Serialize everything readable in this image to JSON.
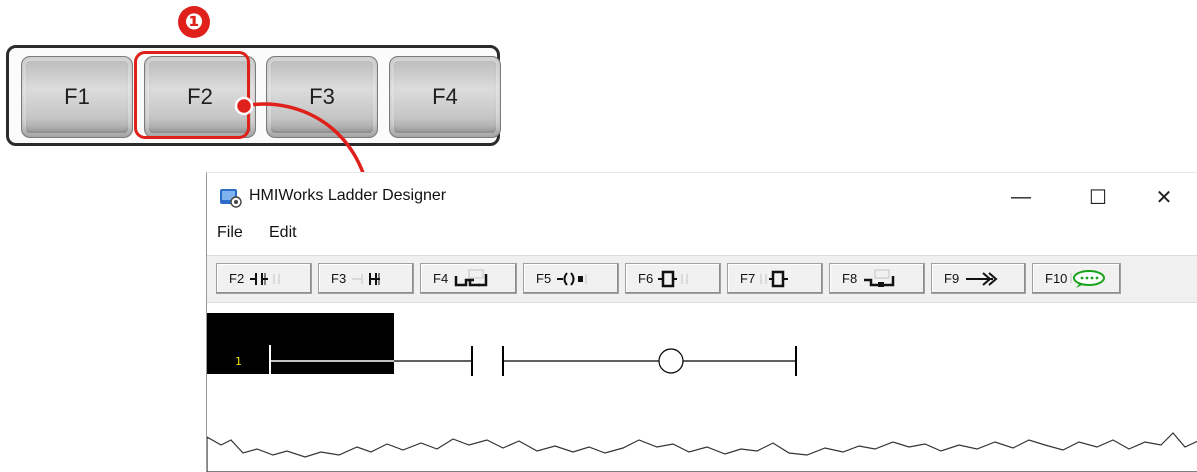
{
  "keyboard": {
    "keys": [
      "F1",
      "F2",
      "F3",
      "F4"
    ],
    "highlighted_key": "F2",
    "step_badge": "❶"
  },
  "window": {
    "title": "HMIWorks Ladder Designer",
    "controls": {
      "minimize": "—",
      "maximize": "☐",
      "close": "✕"
    }
  },
  "menu": {
    "file": "File",
    "edit": "Edit"
  },
  "toolbar": {
    "buttons": [
      {
        "label": "F2",
        "icon": "contact-no-icon"
      },
      {
        "label": "F3",
        "icon": "contact-nc-icon"
      },
      {
        "label": "F4",
        "icon": "branch-icon"
      },
      {
        "label": "F5",
        "icon": "coil-icon"
      },
      {
        "label": "F6",
        "icon": "block-icon"
      },
      {
        "label": "F7",
        "icon": "block-right-icon"
      },
      {
        "label": "F8",
        "icon": "branch-close-icon"
      },
      {
        "label": "F9",
        "icon": "double-arrow-icon"
      },
      {
        "label": "F10",
        "icon": "comment-icon"
      }
    ]
  },
  "ladder": {
    "rung_number": "1"
  },
  "colors": {
    "accent_red": "#e0201b",
    "comment_green": "#1aa31a",
    "rung_number": "#e8e800"
  }
}
